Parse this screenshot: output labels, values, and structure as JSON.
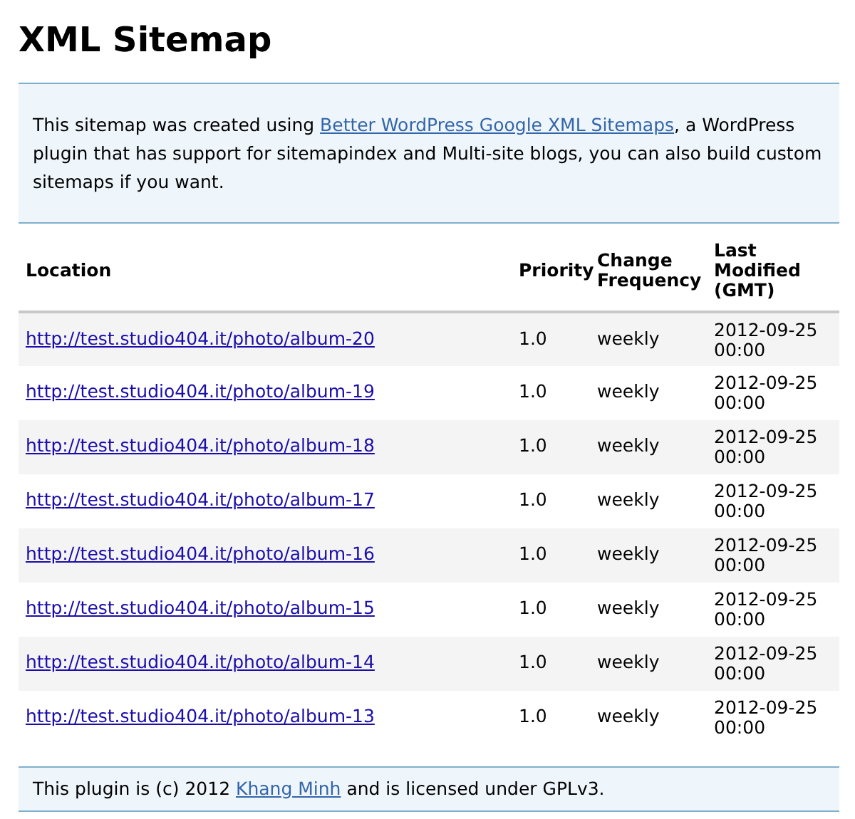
{
  "title": "XML Sitemap",
  "intro": {
    "before": "This sitemap was created using ",
    "link": "Better WordPress Google XML Sitemaps",
    "after": ", a WordPress plugin that has support for sitemapindex and Multi-site blogs, you can also build custom sitemaps if you want."
  },
  "table": {
    "columns": [
      "Location",
      "Priority",
      "Change Frequency",
      "Last Modified (GMT)"
    ],
    "rows": [
      {
        "location": "http://test.studio404.it/photo/album-20",
        "priority": "1.0",
        "change_frequency": "weekly",
        "last_modified": "2012-09-25 00:00"
      },
      {
        "location": "http://test.studio404.it/photo/album-19",
        "priority": "1.0",
        "change_frequency": "weekly",
        "last_modified": "2012-09-25 00:00"
      },
      {
        "location": "http://test.studio404.it/photo/album-18",
        "priority": "1.0",
        "change_frequency": "weekly",
        "last_modified": "2012-09-25 00:00"
      },
      {
        "location": "http://test.studio404.it/photo/album-17",
        "priority": "1.0",
        "change_frequency": "weekly",
        "last_modified": "2012-09-25 00:00"
      },
      {
        "location": "http://test.studio404.it/photo/album-16",
        "priority": "1.0",
        "change_frequency": "weekly",
        "last_modified": "2012-09-25 00:00"
      },
      {
        "location": "http://test.studio404.it/photo/album-15",
        "priority": "1.0",
        "change_frequency": "weekly",
        "last_modified": "2012-09-25 00:00"
      },
      {
        "location": "http://test.studio404.it/photo/album-14",
        "priority": "1.0",
        "change_frequency": "weekly",
        "last_modified": "2012-09-25 00:00"
      },
      {
        "location": "http://test.studio404.it/photo/album-13",
        "priority": "1.0",
        "change_frequency": "weekly",
        "last_modified": "2012-09-25 00:00"
      }
    ]
  },
  "footer": {
    "before": "This plugin is (c) 2012 ",
    "link": "Khang Minh",
    "after": " and is licensed under GPLv3."
  }
}
